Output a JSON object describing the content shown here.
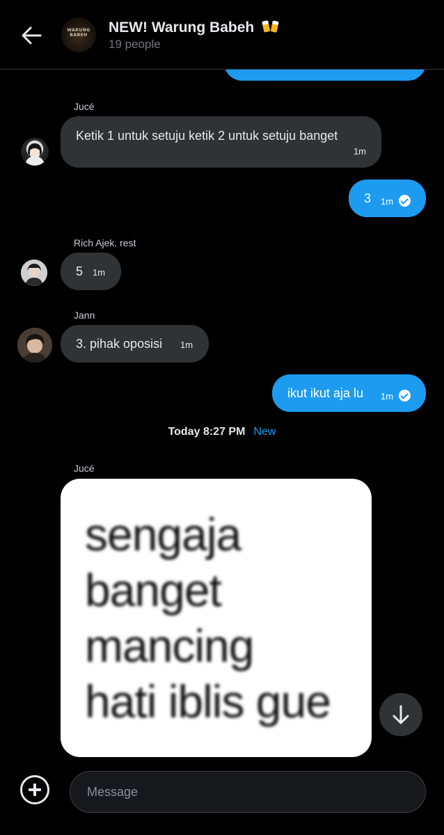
{
  "header": {
    "title": "NEW! Warung Babeh",
    "subtitle": "19 people",
    "avatar_text": "WARUNG BABEH"
  },
  "messages": [
    {
      "sender": "Jucé",
      "text": "Ketik 1 untuk setuju ketik 2 untuk setuju banget",
      "time": "1m"
    },
    {
      "text": "3",
      "time": "1m"
    },
    {
      "sender": "Rich Ajek. rest",
      "text": "5",
      "time": "1m"
    },
    {
      "sender": "Jann",
      "text": "3. pihak oposisi",
      "time": "1m"
    },
    {
      "text": "ikut ikut aja lu",
      "time": "1m"
    }
  ],
  "divider": {
    "timestamp": "Today 8:27 PM",
    "new_label": "New"
  },
  "image_message": {
    "sender": "Jucé",
    "lines": [
      "sengaja",
      "banget",
      "mancing",
      "hati iblis gue"
    ]
  },
  "composer": {
    "placeholder": "Message"
  },
  "colors": {
    "accent": "#1d9bf0",
    "incoming_bubble": "#2f3336",
    "background": "#000000"
  }
}
